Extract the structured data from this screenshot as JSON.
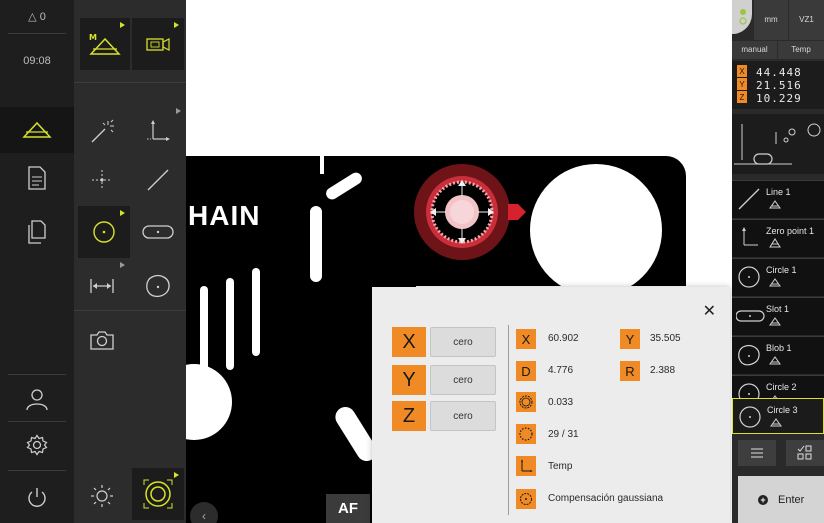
{
  "mainbar": {
    "warning_count": "0",
    "time": "09:08"
  },
  "image_view": {
    "label_text": "HAIN",
    "af_button": "AF"
  },
  "popup": {
    "axes": [
      {
        "label": "X",
        "button": "cero"
      },
      {
        "label": "Y",
        "button": "cero"
      },
      {
        "label": "Z",
        "button": "cero"
      }
    ],
    "results": {
      "x_label": "X",
      "x_value": "60.902",
      "y_label": "Y",
      "y_value": "35.505",
      "d_label": "D",
      "d_value": "4.776",
      "r_label": "R",
      "r_value": "2.388",
      "form_value": "0.033",
      "points_value": "29 / 31",
      "reference_value": "Temp",
      "filter_value": "Compensación gaussiana"
    }
  },
  "right_panel": {
    "unit": "mm",
    "probe": "VZ1",
    "mode": "manual",
    "reference": "Temp",
    "positions": [
      {
        "axis": "X",
        "value": "44.448"
      },
      {
        "axis": "Y",
        "value": "21.516"
      },
      {
        "axis": "Z",
        "value": "10.229"
      }
    ],
    "features": [
      {
        "name": "Line 1"
      },
      {
        "name": "Zero point 1"
      },
      {
        "name": "Circle 1"
      },
      {
        "name": "Slot 1"
      },
      {
        "name": "Blob 1"
      },
      {
        "name": "Circle 2"
      },
      {
        "name": "Circle 3"
      }
    ],
    "enter_button": "Enter"
  },
  "colors": {
    "accent": "#f08a24",
    "highlight": "#d7e22a",
    "dark_bg": "#1e1e1e",
    "panel_bg": "#2c2c2c"
  }
}
